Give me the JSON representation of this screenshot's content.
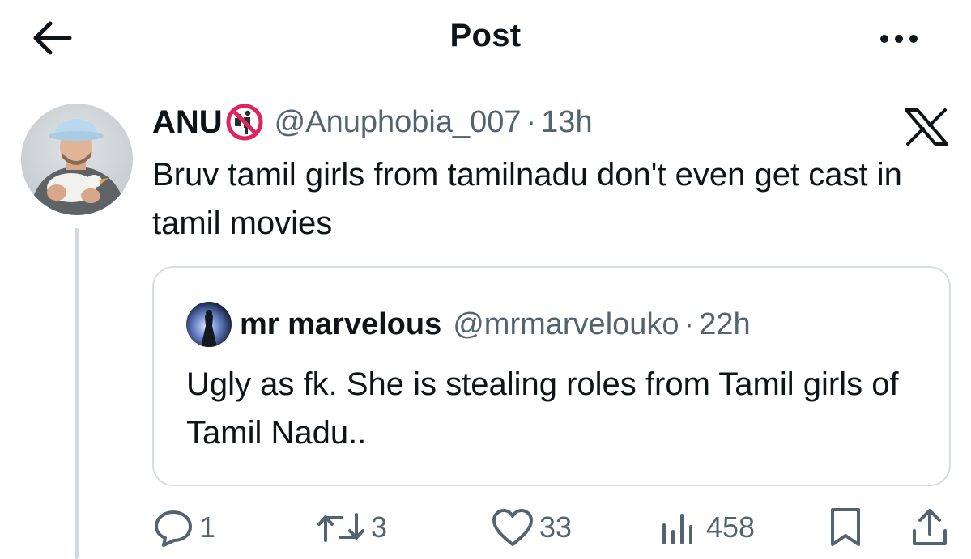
{
  "header": {
    "title": "Post",
    "back_icon": "arrow-left-icon",
    "more_icon": "ellipsis-icon"
  },
  "post": {
    "author_name": "ANU",
    "badge_icon": "prohibited-sign-icon",
    "handle": "@Anuphobia_007",
    "separator": "·",
    "time": "13h",
    "platform_icon": "x-logo-icon",
    "text": "Bruv tamil girls from tamilnadu don't even get cast in tamil movies"
  },
  "quoted": {
    "author_name": "mr marvelous",
    "handle": "@mrmarvelouko",
    "separator": "·",
    "time": "22h",
    "text": "Ugly as fk. She is stealing roles from Tamil girls of Tamil Nadu.."
  },
  "actions": {
    "replies": "1",
    "reposts": "3",
    "likes": "33",
    "views": "458",
    "icons": [
      "reply-icon",
      "repost-icon",
      "like-icon",
      "views-icon",
      "bookmark-icon",
      "share-icon"
    ]
  },
  "colors": {
    "text_primary": "#0f1419",
    "text_secondary": "#536471",
    "border": "#d7dde2",
    "thread_line": "#cfd9de",
    "badge_red": "#e0245e"
  }
}
